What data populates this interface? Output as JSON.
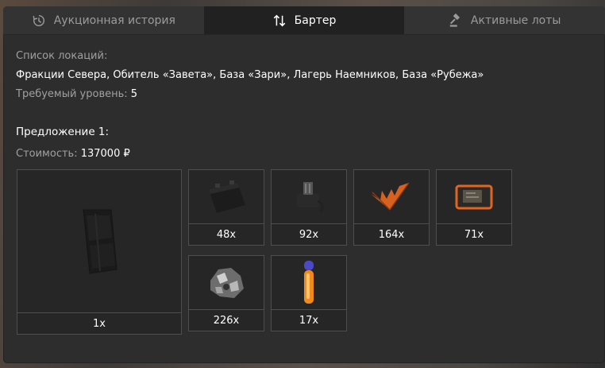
{
  "tabs": [
    {
      "label": "Аукционная история",
      "icon": "history-icon",
      "active": false
    },
    {
      "label": "Бартер",
      "icon": "swap-arrows-icon",
      "active": true
    },
    {
      "label": "Активные лоты",
      "icon": "gavel-icon",
      "active": false
    }
  ],
  "locations": {
    "label": "Список локаций:",
    "value": "Фракции Севера, Обитель «Завета», База «Зари», Лагерь Наемников, База «Рубежа»"
  },
  "level": {
    "label": "Требуемый уровень:",
    "value": "5"
  },
  "offer": {
    "title": "Предложение 1:",
    "cost_label": "Стоимость:",
    "cost_value": "137000 ₽",
    "reward": {
      "icon": "rifle-magazine-icon",
      "qty": "1x"
    },
    "items": [
      {
        "icon": "battery-icon",
        "qty": "48x"
      },
      {
        "icon": "electronic-component-icon",
        "qty": "92x"
      },
      {
        "icon": "orange-fern-icon",
        "qty": "164x"
      },
      {
        "icon": "tablet-device-icon",
        "qty": "71x"
      },
      {
        "icon": "scrap-metal-icon",
        "qty": "226x"
      },
      {
        "icon": "glow-stick-icon",
        "qty": "17x"
      }
    ]
  },
  "colors": {
    "panel_bg": "#2d2d2d",
    "active_tab_bg": "#212121",
    "muted_text": "#a0a0a0",
    "accent_orange": "#e0661f"
  }
}
